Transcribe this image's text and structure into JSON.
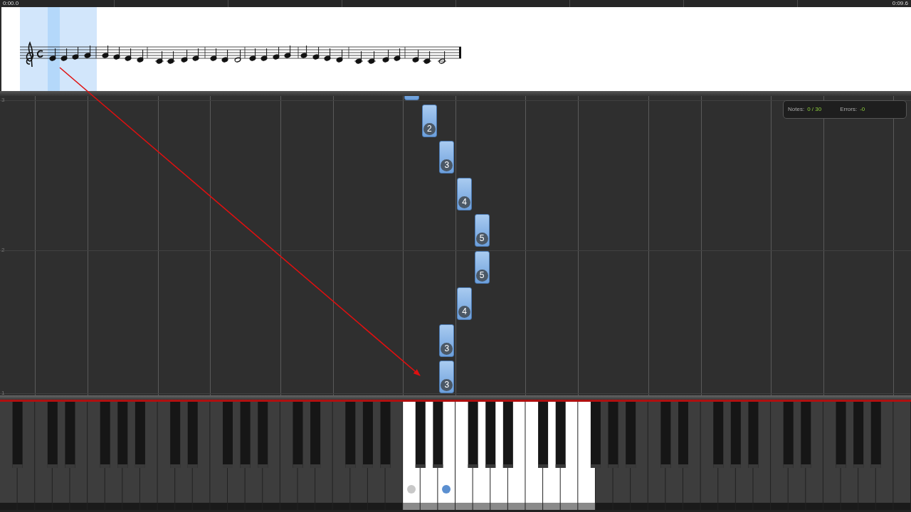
{
  "timeline": {
    "start": "0:00.0",
    "end": "0:09.6"
  },
  "score": {
    "playhead": true
  },
  "measures": [
    "3",
    "2",
    "1"
  ],
  "stats": [
    {
      "label": "Notes:",
      "value": "0 / 30"
    },
    {
      "label": "Errors:",
      "value": "-0"
    }
  ],
  "falling_notes": [
    {
      "cut_off": true
    },
    {
      "finger": "2"
    },
    {
      "finger": "3"
    },
    {
      "finger": "4"
    },
    {
      "finger": "5"
    },
    {
      "finger": "5"
    },
    {
      "finger": "4"
    },
    {
      "finger": "3"
    },
    {
      "finger": "3"
    }
  ],
  "arrow_overlay": true,
  "white_keys": [
    {
      "active": false
    },
    {
      "active": false
    },
    {
      "active": false
    },
    {
      "active": false
    },
    {
      "active": false
    },
    {
      "active": false
    },
    {
      "active": false
    },
    {
      "active": false
    },
    {
      "active": false
    },
    {
      "active": false
    },
    {
      "active": false
    },
    {
      "active": false
    },
    {
      "active": false
    },
    {
      "active": false
    },
    {
      "active": false
    },
    {
      "active": false
    },
    {
      "active": false
    },
    {
      "active": false
    },
    {
      "active": false
    },
    {
      "active": false
    },
    {
      "active": false
    },
    {
      "active": false
    },
    {
      "active": false
    },
    {
      "active": true,
      "color": "#c8c8c8"
    },
    {
      "active": true
    },
    {
      "active": true,
      "color": "#5b8fd0"
    },
    {
      "active": true
    },
    {
      "active": true
    },
    {
      "active": true
    },
    {
      "active": true
    },
    {
      "active": true
    },
    {
      "active": true
    },
    {
      "active": true
    },
    {
      "active": true
    },
    {
      "active": false
    },
    {
      "active": false
    },
    {
      "active": false
    },
    {
      "active": false
    },
    {
      "active": false
    },
    {
      "active": false
    },
    {
      "active": false
    },
    {
      "active": false
    },
    {
      "active": false
    },
    {
      "active": false
    },
    {
      "active": false
    },
    {
      "active": false
    },
    {
      "active": false
    },
    {
      "active": false
    },
    {
      "active": false
    },
    {
      "active": false
    },
    {
      "active": false
    },
    {
      "active": false
    }
  ]
}
